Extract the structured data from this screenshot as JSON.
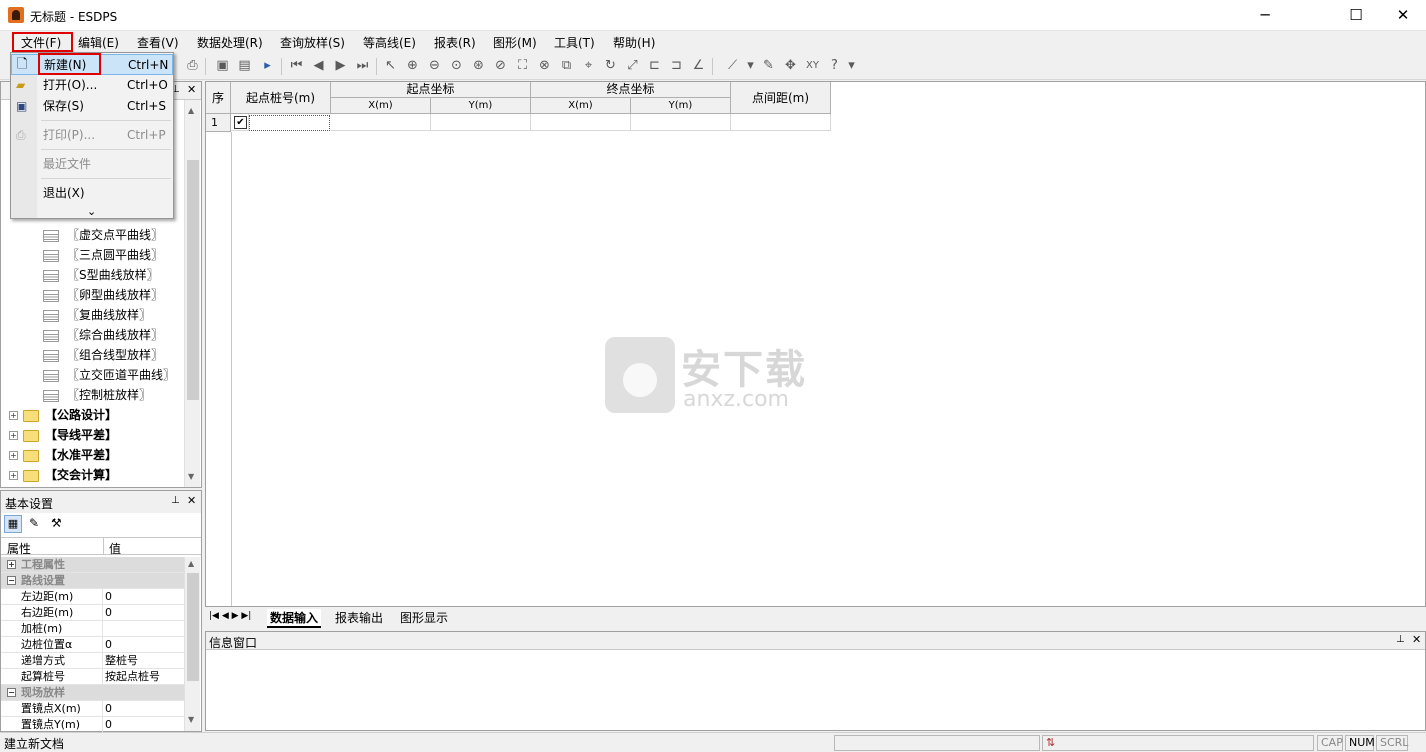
{
  "window": {
    "title": "无标题 - ESDPS",
    "minimize": "─",
    "maximize": "☐",
    "close": "✕"
  },
  "menu": [
    "文件(F)",
    "编辑(E)",
    "查看(V)",
    "数据处理(R)",
    "查询放样(S)",
    "等高线(E)",
    "报表(R)",
    "图形(M)",
    "工具(T)",
    "帮助(H)"
  ],
  "file_menu": {
    "new": {
      "label": "新建(N)",
      "shortcut": "Ctrl+N"
    },
    "open": {
      "label": "打开(O)...",
      "shortcut": "Ctrl+O"
    },
    "save": {
      "label": "保存(S)",
      "shortcut": "Ctrl+S"
    },
    "print": {
      "label": "打印(P)...",
      "shortcut": "Ctrl+P"
    },
    "recent": "最近文件",
    "exit": "退出(X)",
    "more": "⌄"
  },
  "tree": {
    "items": [
      "〖虚交点平曲线〗",
      "〖三点圆平曲线〗",
      "〖S型曲线放样〗",
      "〖卵型曲线放样〗",
      "〖复曲线放样〗",
      "〖综合曲线放样〗",
      "〖组合线型放样〗",
      "〖立交匝道平曲线〗",
      "〖控制桩放样〗"
    ],
    "folders": [
      "【公路设计】",
      "【导线平差】",
      "【水准平差】",
      "【交会计算】"
    ]
  },
  "props": {
    "title": "基本设置",
    "col_attr": "属性",
    "col_val": "值",
    "rows": [
      {
        "type": "cat",
        "key": "工程属性",
        "sign": "+"
      },
      {
        "type": "cat",
        "key": "路线设置",
        "sign": "−"
      },
      {
        "type": "row",
        "key": "左边距(m)",
        "val": "0"
      },
      {
        "type": "row",
        "key": "右边距(m)",
        "val": "0"
      },
      {
        "type": "row",
        "key": "加桩(m)",
        "val": ""
      },
      {
        "type": "row",
        "key": "边桩位置α",
        "val": "0"
      },
      {
        "type": "row",
        "key": "递增方式",
        "val": "整桩号"
      },
      {
        "type": "row",
        "key": "起算桩号",
        "val": "按起点桩号"
      },
      {
        "type": "cat",
        "key": "现场放样",
        "sign": "−"
      },
      {
        "type": "row",
        "key": "置镜点X(m)",
        "val": "0"
      },
      {
        "type": "row",
        "key": "置镜点Y(m)",
        "val": "0"
      }
    ]
  },
  "grid": {
    "seq": "序",
    "start_station": "起点桩号(m)",
    "start_coord": "起点坐标",
    "end_coord": "终点坐标",
    "x": "X(m)",
    "y": "Y(m)",
    "distance": "点间距(m)",
    "row1": "1"
  },
  "tabs": {
    "nav": "|◀ ◀ ▶ ▶|",
    "input": "数据输入",
    "report": "报表输出",
    "graph": "图形显示"
  },
  "info": {
    "title": "信息窗口"
  },
  "watermark": {
    "big": "安下载",
    "small": "anxz.com"
  },
  "status": {
    "text": "建立新文档",
    "cap": "CAP",
    "num": "NUM",
    "scrl": "SCRL"
  },
  "panel_ctrl": {
    "pin": "⊥",
    "close": "✕"
  }
}
